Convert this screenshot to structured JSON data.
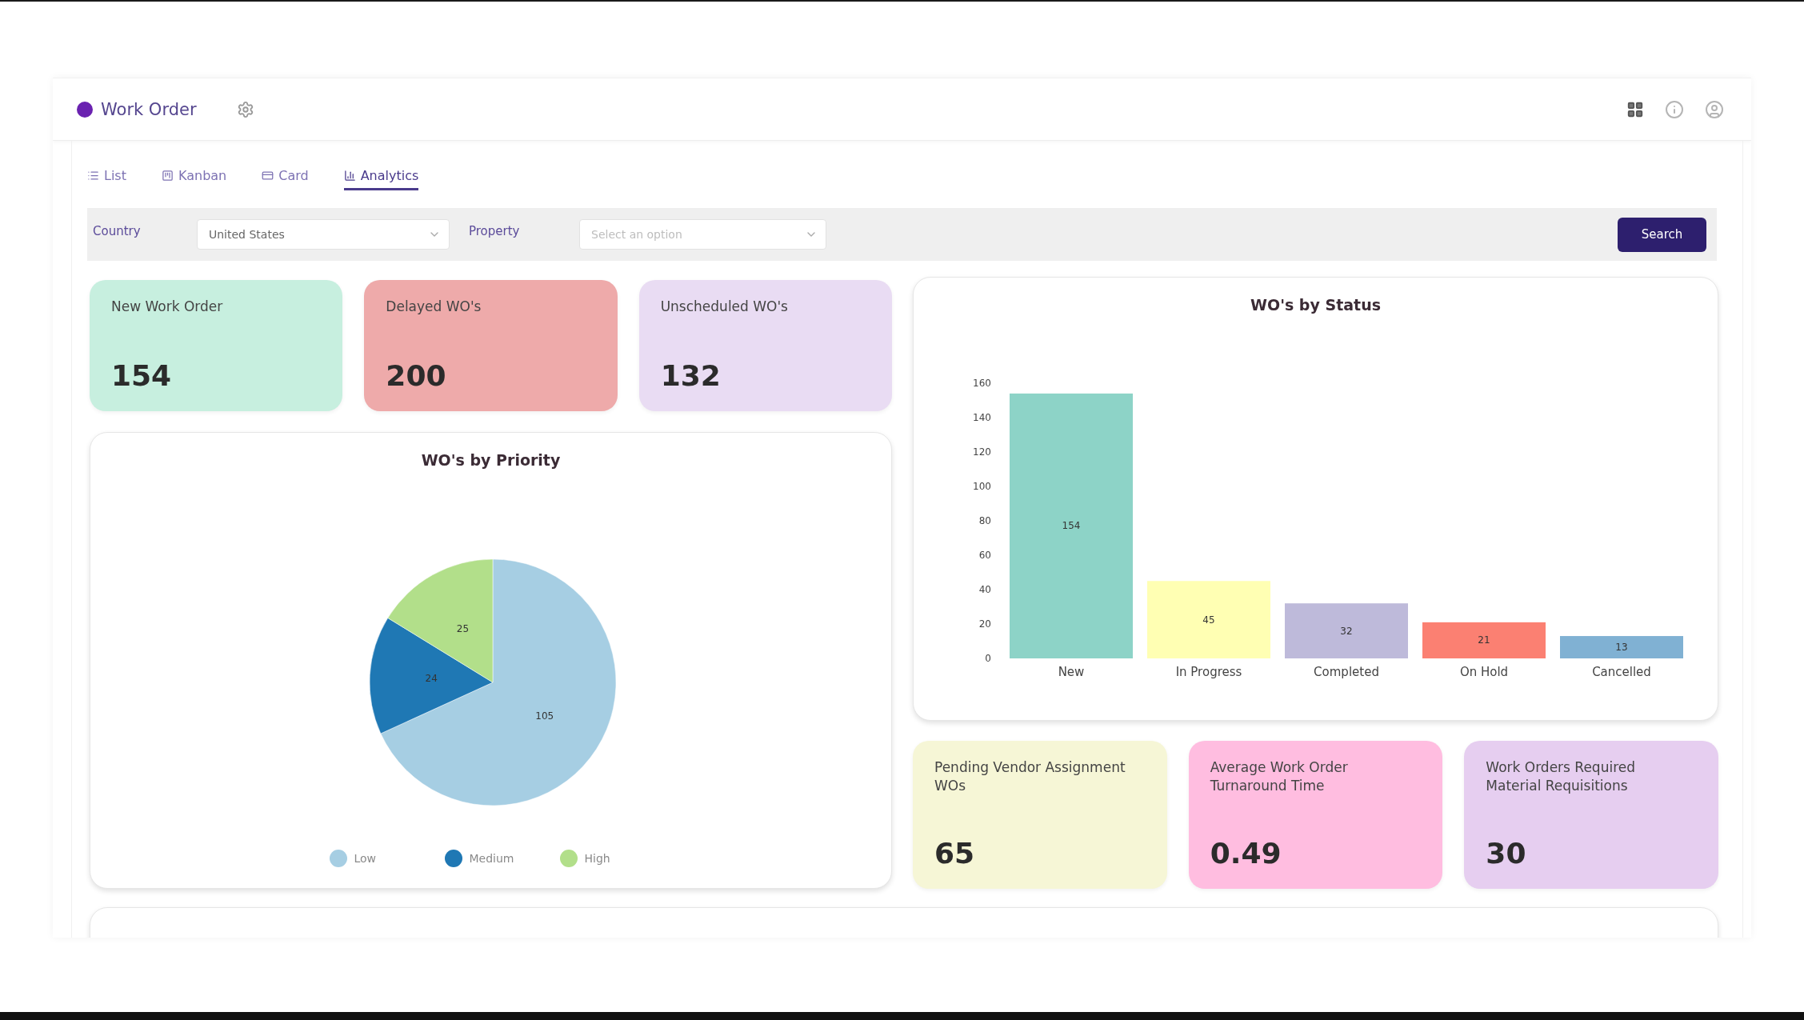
{
  "header": {
    "title": "Work Order"
  },
  "tabs": [
    {
      "label": "List",
      "selected": false
    },
    {
      "label": "Kanban",
      "selected": false
    },
    {
      "label": "Card",
      "selected": false
    },
    {
      "label": "Analytics",
      "selected": true
    }
  ],
  "filters": {
    "country": {
      "label": "Country",
      "value": "United States"
    },
    "property": {
      "label": "Property",
      "placeholder": "Select an option"
    },
    "search_button": "Search"
  },
  "summary_cards": [
    {
      "label": "New Work Order",
      "value": "154",
      "color": "#c7efdf"
    },
    {
      "label": "Delayed WO's",
      "value": "200",
      "color": "#eeaaaa"
    },
    {
      "label": "Unscheduled WO's",
      "value": "132",
      "color": "#e9dcf3"
    }
  ],
  "priority_chart": {
    "chart_data": {
      "type": "pie",
      "title": "WO's by Priority",
      "categories": [
        "Low",
        "Medium",
        "High"
      ],
      "values": [
        105,
        24,
        25
      ],
      "data_labels": true,
      "legend": "bottom"
    }
  },
  "status_chart": {
    "chart_data": {
      "type": "bar",
      "title": "WO's by Status",
      "categories": [
        "New",
        "In Progress",
        "Completed",
        "On Hold",
        "Cancelled"
      ],
      "values": [
        154,
        45,
        32,
        21,
        13
      ],
      "ylim": [
        0,
        160
      ],
      "yticks": [
        0,
        20,
        40,
        60,
        80,
        100,
        120,
        140,
        160
      ],
      "data_labels": true
    }
  },
  "metric_cards": [
    {
      "label": "Pending Vendor Assignment WOs",
      "value": "65",
      "color": "#f6f6d6"
    },
    {
      "label": "Average Work Order Turnaround Time",
      "value": "0.49",
      "color": "#ffbde0"
    },
    {
      "label": "Work Orders Required Material Requisitions",
      "value": "30",
      "color": "#e6cef0"
    }
  ]
}
